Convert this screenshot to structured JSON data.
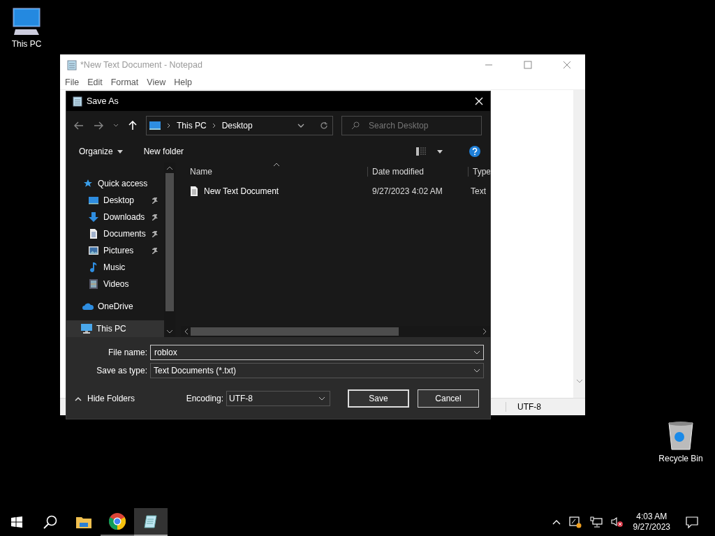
{
  "desktop_icons": [
    {
      "label": "This PC",
      "kind": "pc"
    },
    {
      "label": "Recycle Bin",
      "kind": "bin"
    }
  ],
  "notepad": {
    "title": "*New Text Document - Notepad",
    "menu": [
      "File",
      "Edit",
      "Format",
      "View",
      "Help"
    ],
    "status_encoding": "UTF-8"
  },
  "dialog": {
    "title": "Save As",
    "breadcrumb": [
      "This PC",
      "Desktop"
    ],
    "search": {
      "placeholder": "Search Desktop"
    },
    "toolbar": {
      "organize": "Organize",
      "new_folder": "New folder"
    },
    "nav": [
      {
        "label": "Quick access",
        "kind": "star",
        "selected": false,
        "children": [
          {
            "label": "Desktop",
            "kind": "desktop",
            "pinned": true,
            "selected": false
          },
          {
            "label": "Downloads",
            "kind": "downloads",
            "pinned": true,
            "selected": false
          },
          {
            "label": "Documents",
            "kind": "documents",
            "pinned": true,
            "selected": false
          },
          {
            "label": "Pictures",
            "kind": "pictures",
            "pinned": true,
            "selected": false
          },
          {
            "label": "Music",
            "kind": "music",
            "pinned": false,
            "selected": false
          },
          {
            "label": "Videos",
            "kind": "videos",
            "pinned": false,
            "selected": false
          }
        ]
      },
      {
        "label": "OneDrive",
        "kind": "cloud",
        "selected": false
      },
      {
        "label": "This PC",
        "kind": "pc",
        "selected": true
      }
    ],
    "columns": [
      "Name",
      "Date modified",
      "Type"
    ],
    "files": [
      {
        "name": "New Text Document",
        "date": "9/27/2023 4:02 AM",
        "type": "Text"
      }
    ],
    "file_name_label": "File name:",
    "file_name": "roblox",
    "type_label": "Save as type:",
    "save_as_type": "Text Documents (*.txt)",
    "hide_folders": "Hide Folders",
    "encoding_label": "Encoding:",
    "encoding": "UTF-8",
    "buttons": [
      "Save",
      "Cancel"
    ]
  },
  "taskbar": {
    "apps": [
      {
        "kind": "start",
        "running": false,
        "active": false
      },
      {
        "kind": "search",
        "running": false,
        "active": false
      },
      {
        "kind": "explorer",
        "running": false,
        "active": false
      },
      {
        "kind": "chrome",
        "running": true,
        "active": false
      },
      {
        "kind": "notepad",
        "running": true,
        "active": true
      }
    ],
    "time": "4:03 AM",
    "date": "9/27/2023"
  }
}
